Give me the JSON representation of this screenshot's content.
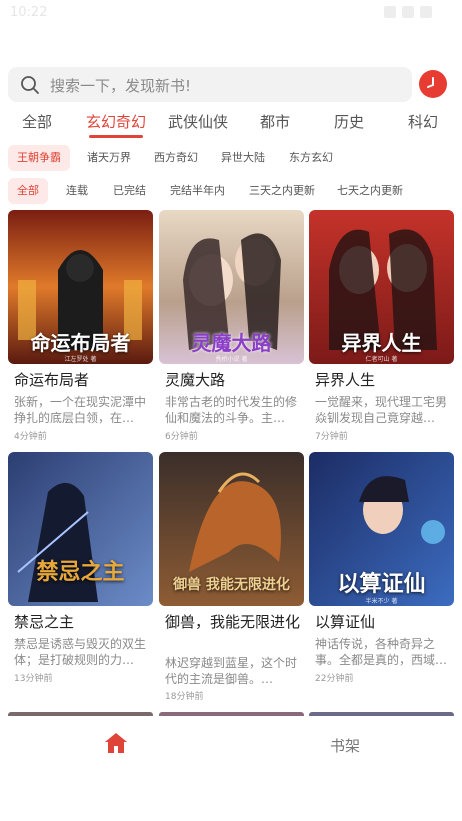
{
  "statusbar": {
    "time": "10:22"
  },
  "search": {
    "placeholder": "搜索一下，发现新书!"
  },
  "tabs": [
    "全部",
    "玄幻奇幻",
    "武侠仙侠",
    "都市",
    "历史",
    "科幻"
  ],
  "active_tab": "玄幻奇幻",
  "subgenres": [
    "王朝争霸",
    "诸天万界",
    "西方奇幻",
    "异世大陆",
    "东方玄幻"
  ],
  "filters": [
    "全部",
    "连载",
    "已完结",
    "完结半年内",
    "三天之内更新",
    "七天之内更新"
  ],
  "books": [
    {
      "title": "命运布局者",
      "desc": "张新，一个在现实泥潭中挣扎的底层白领，在…",
      "time": "4分钟前",
      "cover_text": "命运布局者",
      "cover_author": "江左罗处 著"
    },
    {
      "title": "灵魔大路",
      "desc": "非常古老的时代发生的修仙和魔法的斗争。主…",
      "time": "6分钟前",
      "cover_text": "灵魔大路",
      "cover_author": "秀桥小说 著"
    },
    {
      "title": "异界人生",
      "desc": "一觉醒来，现代理工宅男焱钏发现自己竟穿越…",
      "time": "7分钟前",
      "cover_text": "异界人生",
      "cover_author": "仁者可山 著"
    },
    {
      "title": "禁忌之主",
      "desc": "禁忌是诱惑与毁灭的双生体；是打破规则的力…",
      "time": "13分钟前",
      "cover_text": "禁忌之主",
      "cover_author": ""
    },
    {
      "title": "御兽，我能无限进化",
      "desc": "林迟穿越到蓝星，这个时代的主流是御兽。…",
      "time": "18分钟前",
      "cover_text": "御兽 我能无限进化",
      "cover_author": ""
    },
    {
      "title": "以算证仙",
      "desc": "神话传说，各种奇异之事。全都是真的，西域…",
      "time": "22分钟前",
      "cover_text": "以算证仙",
      "cover_author": "半米不少 著"
    }
  ],
  "bottom_nav": {
    "home": "home-icon",
    "shelf": "书架"
  },
  "colors": {
    "accent": "#e04438",
    "chip_bg": "#fde9e7"
  }
}
